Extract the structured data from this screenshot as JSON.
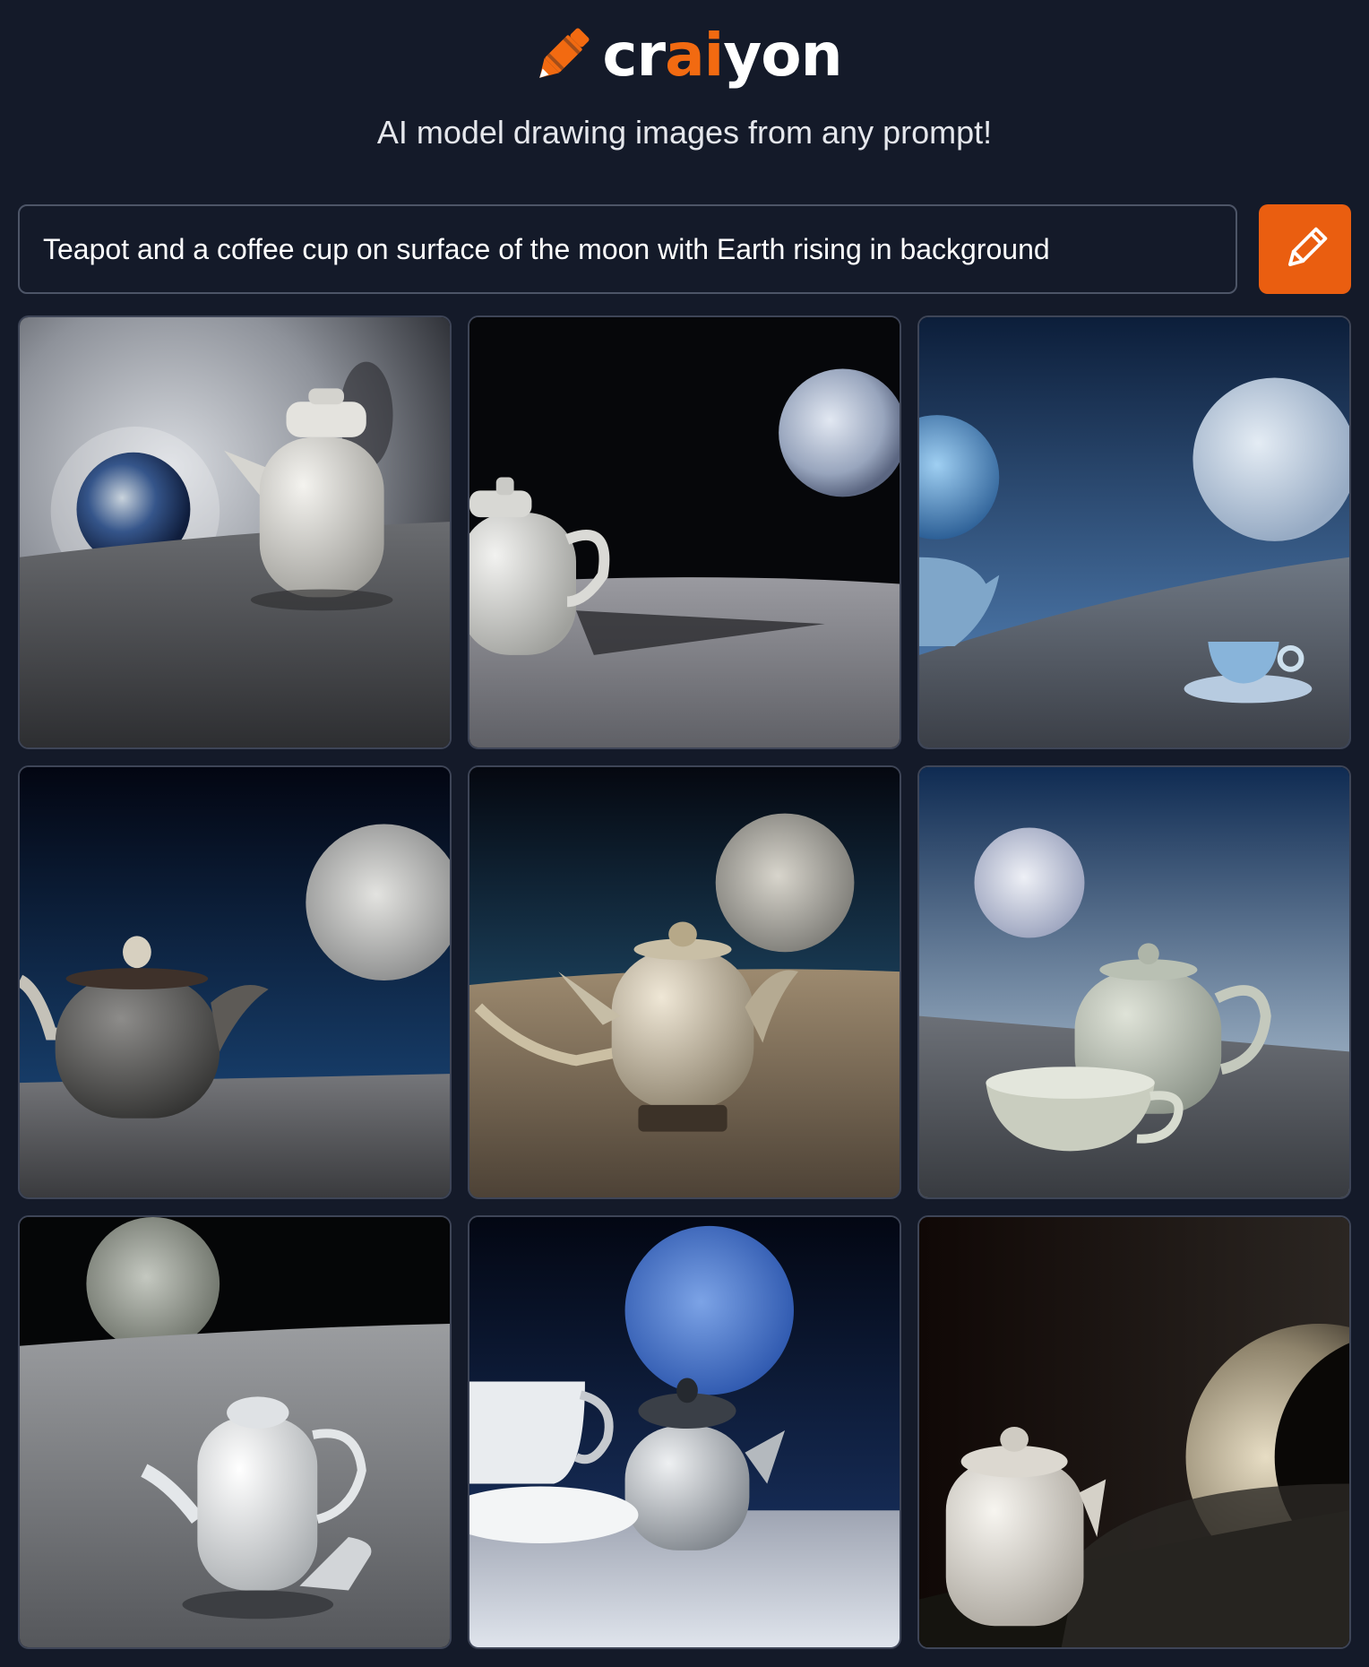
{
  "header": {
    "logo_prefix": "cr",
    "logo_accent": "ai",
    "logo_suffix": "yon",
    "logo_icon": "crayon-icon",
    "tagline": "AI model drawing images from any prompt!"
  },
  "prompt": {
    "value": "Teapot and a coffee cup on surface of the moon with Earth rising in background",
    "button_icon": "pencil-icon"
  },
  "colors": {
    "background": "#141a29",
    "accent": "#f26a11",
    "button": "#ea5e10",
    "border": "#4d5567"
  },
  "results": {
    "count": 9
  }
}
